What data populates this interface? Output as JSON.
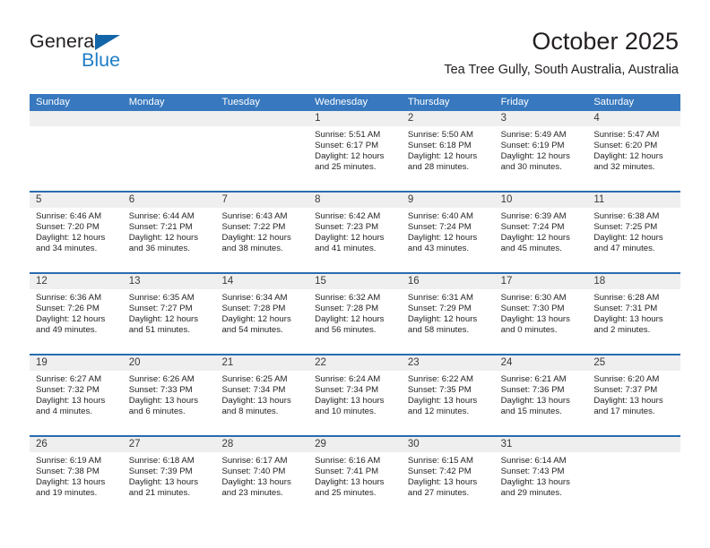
{
  "brand": {
    "name_part1": "General",
    "name_part2": "Blue",
    "flag_icon": "triangle-flag-icon"
  },
  "header": {
    "month_title": "October 2025",
    "location": "Tea Tree Gully, South Australia, Australia"
  },
  "colors": {
    "header_blue": "#3778be",
    "row_divider_blue": "#2a6cb0",
    "number_band_gray": "#efeff0",
    "brand_blue": "#1e7ec8",
    "flag_blue": "#1265a8",
    "text": "#231f20"
  },
  "day_headers": [
    "Sunday",
    "Monday",
    "Tuesday",
    "Wednesday",
    "Thursday",
    "Friday",
    "Saturday"
  ],
  "weeks": [
    {
      "days": [
        {
          "number": "",
          "lines": []
        },
        {
          "number": "",
          "lines": []
        },
        {
          "number": "",
          "lines": []
        },
        {
          "number": "1",
          "lines": [
            "Sunrise: 5:51 AM",
            "Sunset: 6:17 PM",
            "Daylight: 12 hours",
            "and 25 minutes."
          ]
        },
        {
          "number": "2",
          "lines": [
            "Sunrise: 5:50 AM",
            "Sunset: 6:18 PM",
            "Daylight: 12 hours",
            "and 28 minutes."
          ]
        },
        {
          "number": "3",
          "lines": [
            "Sunrise: 5:49 AM",
            "Sunset: 6:19 PM",
            "Daylight: 12 hours",
            "and 30 minutes."
          ]
        },
        {
          "number": "4",
          "lines": [
            "Sunrise: 5:47 AM",
            "Sunset: 6:20 PM",
            "Daylight: 12 hours",
            "and 32 minutes."
          ]
        }
      ]
    },
    {
      "days": [
        {
          "number": "5",
          "lines": [
            "Sunrise: 6:46 AM",
            "Sunset: 7:20 PM",
            "Daylight: 12 hours",
            "and 34 minutes."
          ]
        },
        {
          "number": "6",
          "lines": [
            "Sunrise: 6:44 AM",
            "Sunset: 7:21 PM",
            "Daylight: 12 hours",
            "and 36 minutes."
          ]
        },
        {
          "number": "7",
          "lines": [
            "Sunrise: 6:43 AM",
            "Sunset: 7:22 PM",
            "Daylight: 12 hours",
            "and 38 minutes."
          ]
        },
        {
          "number": "8",
          "lines": [
            "Sunrise: 6:42 AM",
            "Sunset: 7:23 PM",
            "Daylight: 12 hours",
            "and 41 minutes."
          ]
        },
        {
          "number": "9",
          "lines": [
            "Sunrise: 6:40 AM",
            "Sunset: 7:24 PM",
            "Daylight: 12 hours",
            "and 43 minutes."
          ]
        },
        {
          "number": "10",
          "lines": [
            "Sunrise: 6:39 AM",
            "Sunset: 7:24 PM",
            "Daylight: 12 hours",
            "and 45 minutes."
          ]
        },
        {
          "number": "11",
          "lines": [
            "Sunrise: 6:38 AM",
            "Sunset: 7:25 PM",
            "Daylight: 12 hours",
            "and 47 minutes."
          ]
        }
      ]
    },
    {
      "days": [
        {
          "number": "12",
          "lines": [
            "Sunrise: 6:36 AM",
            "Sunset: 7:26 PM",
            "Daylight: 12 hours",
            "and 49 minutes."
          ]
        },
        {
          "number": "13",
          "lines": [
            "Sunrise: 6:35 AM",
            "Sunset: 7:27 PM",
            "Daylight: 12 hours",
            "and 51 minutes."
          ]
        },
        {
          "number": "14",
          "lines": [
            "Sunrise: 6:34 AM",
            "Sunset: 7:28 PM",
            "Daylight: 12 hours",
            "and 54 minutes."
          ]
        },
        {
          "number": "15",
          "lines": [
            "Sunrise: 6:32 AM",
            "Sunset: 7:28 PM",
            "Daylight: 12 hours",
            "and 56 minutes."
          ]
        },
        {
          "number": "16",
          "lines": [
            "Sunrise: 6:31 AM",
            "Sunset: 7:29 PM",
            "Daylight: 12 hours",
            "and 58 minutes."
          ]
        },
        {
          "number": "17",
          "lines": [
            "Sunrise: 6:30 AM",
            "Sunset: 7:30 PM",
            "Daylight: 13 hours",
            "and 0 minutes."
          ]
        },
        {
          "number": "18",
          "lines": [
            "Sunrise: 6:28 AM",
            "Sunset: 7:31 PM",
            "Daylight: 13 hours",
            "and 2 minutes."
          ]
        }
      ]
    },
    {
      "days": [
        {
          "number": "19",
          "lines": [
            "Sunrise: 6:27 AM",
            "Sunset: 7:32 PM",
            "Daylight: 13 hours",
            "and 4 minutes."
          ]
        },
        {
          "number": "20",
          "lines": [
            "Sunrise: 6:26 AM",
            "Sunset: 7:33 PM",
            "Daylight: 13 hours",
            "and 6 minutes."
          ]
        },
        {
          "number": "21",
          "lines": [
            "Sunrise: 6:25 AM",
            "Sunset: 7:34 PM",
            "Daylight: 13 hours",
            "and 8 minutes."
          ]
        },
        {
          "number": "22",
          "lines": [
            "Sunrise: 6:24 AM",
            "Sunset: 7:34 PM",
            "Daylight: 13 hours",
            "and 10 minutes."
          ]
        },
        {
          "number": "23",
          "lines": [
            "Sunrise: 6:22 AM",
            "Sunset: 7:35 PM",
            "Daylight: 13 hours",
            "and 12 minutes."
          ]
        },
        {
          "number": "24",
          "lines": [
            "Sunrise: 6:21 AM",
            "Sunset: 7:36 PM",
            "Daylight: 13 hours",
            "and 15 minutes."
          ]
        },
        {
          "number": "25",
          "lines": [
            "Sunrise: 6:20 AM",
            "Sunset: 7:37 PM",
            "Daylight: 13 hours",
            "and 17 minutes."
          ]
        }
      ]
    },
    {
      "days": [
        {
          "number": "26",
          "lines": [
            "Sunrise: 6:19 AM",
            "Sunset: 7:38 PM",
            "Daylight: 13 hours",
            "and 19 minutes."
          ]
        },
        {
          "number": "27",
          "lines": [
            "Sunrise: 6:18 AM",
            "Sunset: 7:39 PM",
            "Daylight: 13 hours",
            "and 21 minutes."
          ]
        },
        {
          "number": "28",
          "lines": [
            "Sunrise: 6:17 AM",
            "Sunset: 7:40 PM",
            "Daylight: 13 hours",
            "and 23 minutes."
          ]
        },
        {
          "number": "29",
          "lines": [
            "Sunrise: 6:16 AM",
            "Sunset: 7:41 PM",
            "Daylight: 13 hours",
            "and 25 minutes."
          ]
        },
        {
          "number": "30",
          "lines": [
            "Sunrise: 6:15 AM",
            "Sunset: 7:42 PM",
            "Daylight: 13 hours",
            "and 27 minutes."
          ]
        },
        {
          "number": "31",
          "lines": [
            "Sunrise: 6:14 AM",
            "Sunset: 7:43 PM",
            "Daylight: 13 hours",
            "and 29 minutes."
          ]
        },
        {
          "number": "",
          "lines": []
        }
      ]
    }
  ]
}
